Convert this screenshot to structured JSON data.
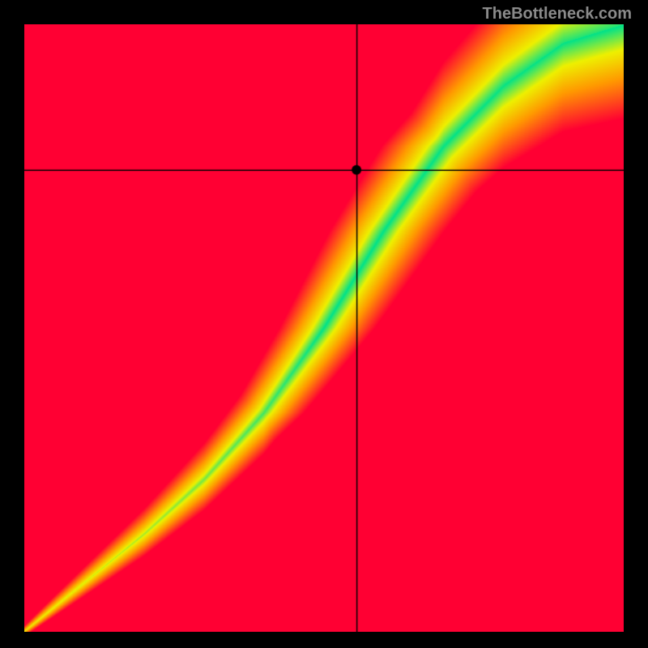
{
  "watermark": "TheBottleneck.com",
  "chart_data": {
    "type": "heatmap",
    "title": "",
    "xlabel": "",
    "ylabel": "",
    "xlim": [
      0,
      1
    ],
    "ylim": [
      0,
      1
    ],
    "crosshair": {
      "x": 0.555,
      "y": 0.76
    },
    "marker": {
      "x": 0.555,
      "y": 0.76
    },
    "optimal_band": {
      "description": "Green diagonal band through heatmap",
      "center_path": [
        {
          "x": 0.0,
          "y": 0.0
        },
        {
          "x": 0.1,
          "y": 0.08
        },
        {
          "x": 0.2,
          "y": 0.16
        },
        {
          "x": 0.3,
          "y": 0.25
        },
        {
          "x": 0.4,
          "y": 0.36
        },
        {
          "x": 0.5,
          "y": 0.5
        },
        {
          "x": 0.6,
          "y": 0.66
        },
        {
          "x": 0.7,
          "y": 0.8
        },
        {
          "x": 0.8,
          "y": 0.9
        },
        {
          "x": 0.9,
          "y": 0.97
        },
        {
          "x": 1.0,
          "y": 1.0
        }
      ],
      "half_width_start": 0.005,
      "half_width_end": 0.075
    },
    "colorscale": [
      {
        "t": 0.0,
        "color": "#00e28a"
      },
      {
        "t": 0.25,
        "color": "#eef000"
      },
      {
        "t": 0.55,
        "color": "#ff9a00"
      },
      {
        "t": 1.0,
        "color": "#ff0033"
      }
    ]
  }
}
